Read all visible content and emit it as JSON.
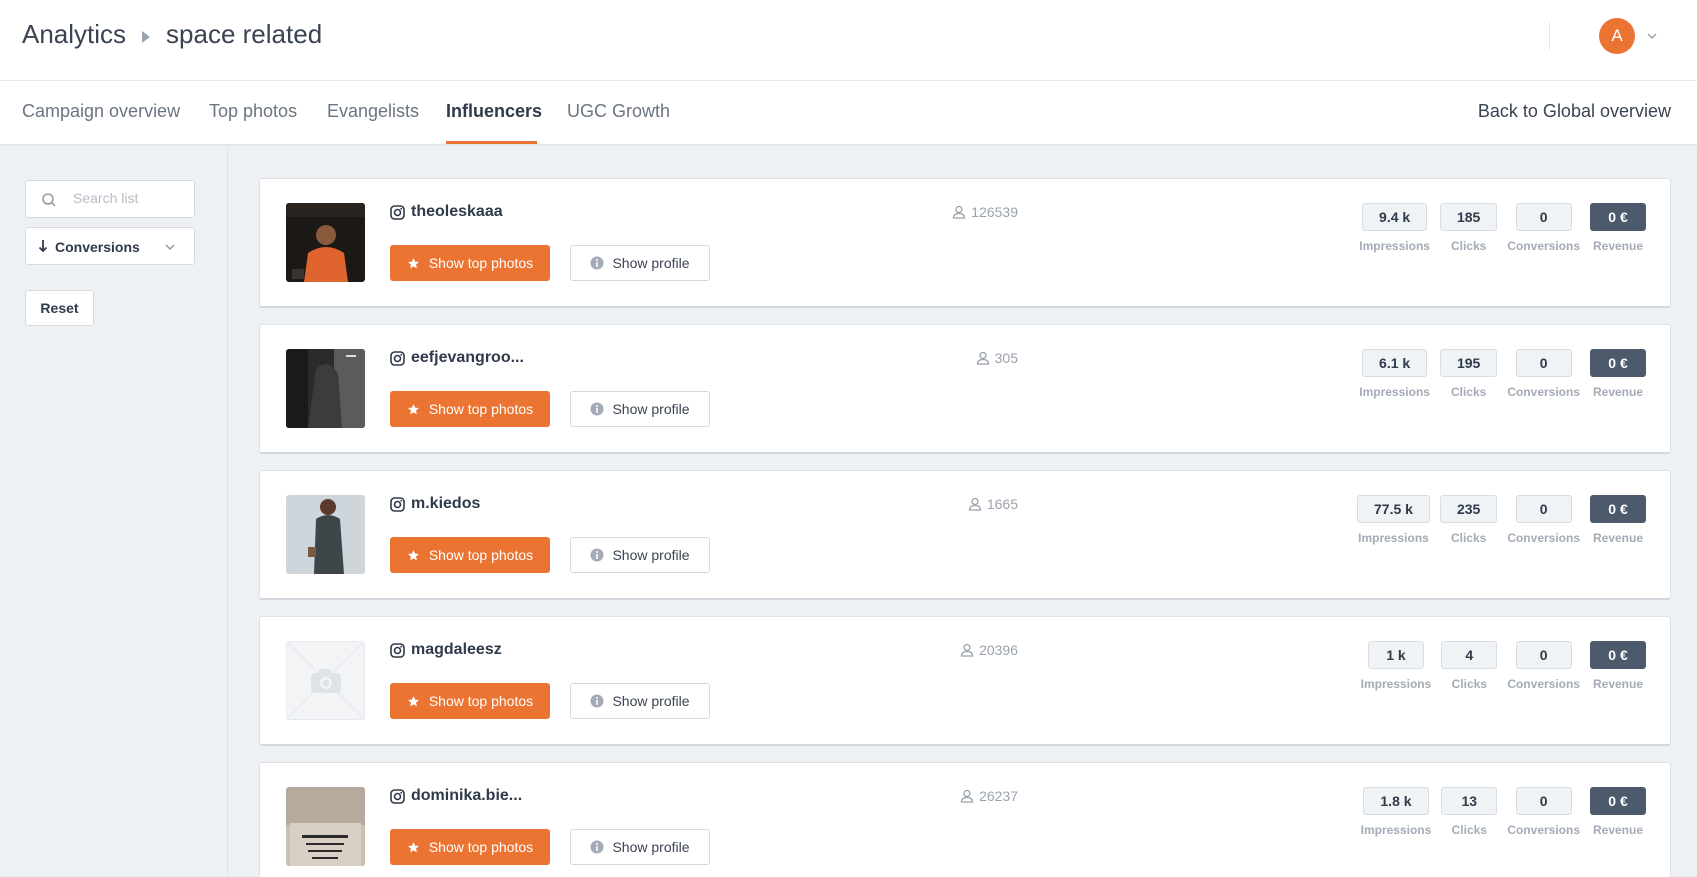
{
  "header": {
    "breadcrumb_root": "Analytics",
    "breadcrumb_current": "space related",
    "avatar_letter": "A"
  },
  "tabs": [
    {
      "label": "Campaign overview"
    },
    {
      "label": "Top photos"
    },
    {
      "label": "Evangelists"
    },
    {
      "label": "Influencers"
    },
    {
      "label": "UGC Growth"
    }
  ],
  "back_link": "Back to Global overview",
  "sidebar": {
    "search_placeholder": "Search list",
    "search_value": "",
    "sort_label": "Conversions",
    "reset_label": "Reset"
  },
  "buttons": {
    "top_photos": "Show top photos",
    "profile": "Show profile"
  },
  "metric_labels": {
    "impressions": "Impressions",
    "clicks": "Clicks",
    "conversions": "Conversions",
    "revenue": "Revenue"
  },
  "colors": {
    "accent": "#ec7432",
    "revenue_bg": "#4d5a6c"
  },
  "influencers": [
    {
      "handle": "theoleskaaa",
      "followers": "126539",
      "impressions": "9.4 k",
      "clicks": "185",
      "conversions": "0",
      "revenue": "0 €"
    },
    {
      "handle": "eefjevangroo...",
      "followers": "305",
      "impressions": "6.1 k",
      "clicks": "195",
      "conversions": "0",
      "revenue": "0 €"
    },
    {
      "handle": "m.kiedos",
      "followers": "1665",
      "impressions": "77.5 k",
      "clicks": "235",
      "conversions": "0",
      "revenue": "0 €"
    },
    {
      "handle": "magdaleesz",
      "followers": "20396",
      "impressions": "1 k",
      "clicks": "4",
      "conversions": "0",
      "revenue": "0 €"
    },
    {
      "handle": "dominika.bie...",
      "followers": "26237",
      "impressions": "1.8 k",
      "clicks": "13",
      "conversions": "0",
      "revenue": "0 €"
    }
  ]
}
